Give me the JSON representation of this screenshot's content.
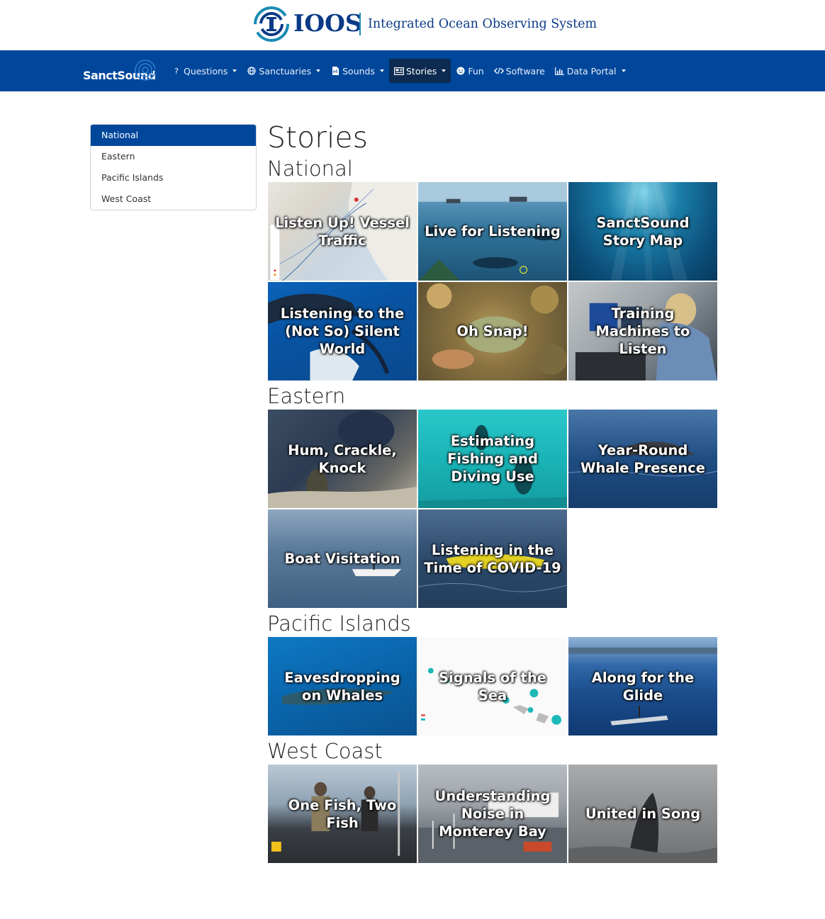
{
  "header": {
    "logo_word": "IOOS",
    "logo_full": "Integrated Ocean Observing System"
  },
  "navbar": {
    "brand": "SanctSound",
    "items": [
      {
        "label": "Questions",
        "icon": "question-icon",
        "dropdown": true
      },
      {
        "label": "Sanctuaries",
        "icon": "globe-icon",
        "dropdown": true
      },
      {
        "label": "Sounds",
        "icon": "audio-file-icon",
        "dropdown": true
      },
      {
        "label": "Stories",
        "icon": "newspaper-icon",
        "dropdown": true,
        "active": true
      },
      {
        "label": "Fun",
        "icon": "smile-icon",
        "dropdown": false
      },
      {
        "label": "Software",
        "icon": "code-icon",
        "dropdown": false
      },
      {
        "label": "Data Portal",
        "icon": "bar-chart-icon",
        "dropdown": true
      }
    ],
    "colors": {
      "bar": "#00479c",
      "active": "#0d2a50"
    }
  },
  "sidebar": {
    "items": [
      {
        "label": "National",
        "active": true
      },
      {
        "label": "Eastern"
      },
      {
        "label": "Pacific Islands"
      },
      {
        "label": "West Coast"
      }
    ]
  },
  "main": {
    "title": "Stories",
    "sections": [
      {
        "name": "National",
        "tiles": [
          "Listen Up! Vessel Traffic",
          "Live for Listening",
          "SanctSound Story Map",
          "Listening to the (Not So) Silent World",
          "Oh Snap!",
          "Training Machines to Listen"
        ]
      },
      {
        "name": "Eastern",
        "tiles": [
          "Hum, Crackle, Knock",
          "Estimating Fishing and Diving Use",
          "Year-Round Whale Presence",
          "Boat Visitation",
          "Listening in the Time of COVID-19"
        ]
      },
      {
        "name": "Pacific Islands",
        "tiles": [
          "Eavesdropping on Whales",
          "Signals of the Sea",
          "Along for the Glide"
        ]
      },
      {
        "name": "West Coast",
        "tiles": [
          "One Fish, Two Fish",
          "Understanding Noise in Monterey Bay",
          "United in Song"
        ]
      }
    ]
  }
}
